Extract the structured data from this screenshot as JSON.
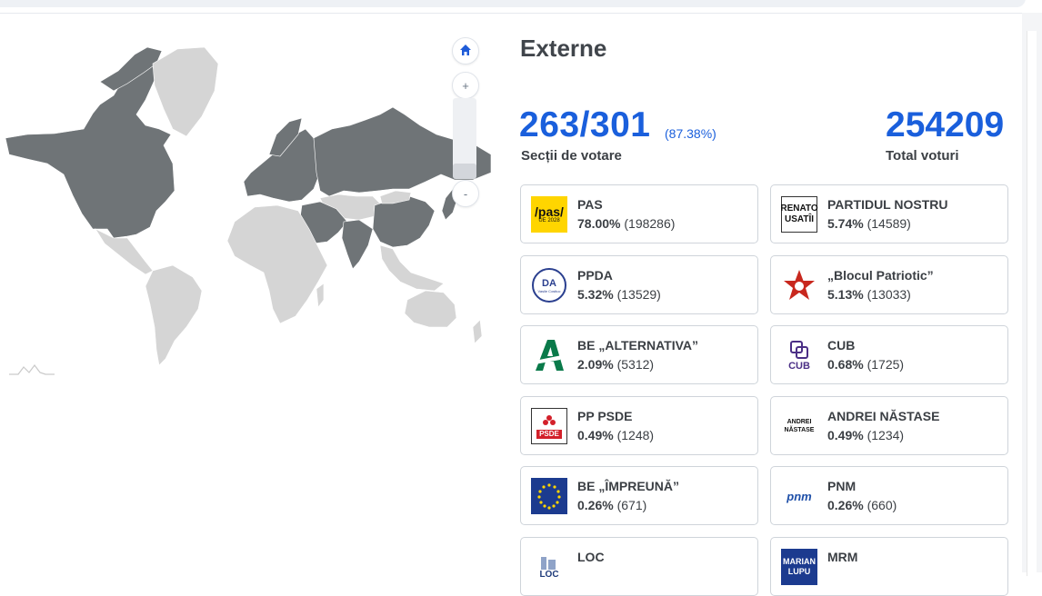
{
  "panel": {
    "title": "Externe",
    "sections_counted": "263/301",
    "sections_percent": "(87.38%)",
    "sections_label": "Secții de votare",
    "total_votes": "254209",
    "total_label": "Total voturi"
  },
  "map_controls": {
    "home_icon": "home-icon",
    "zoom_in": "+",
    "zoom_out": "-"
  },
  "colors": {
    "accent": "#1a5fdc",
    "map_active": "#6f7477",
    "map_inactive": "#d5d5d5"
  },
  "parties": [
    {
      "name": "PAS",
      "percent": "78.00%",
      "votes": "(198286)",
      "logo": "pas-logo",
      "logo_text": "/pas/",
      "logo_sub": "UE 2028"
    },
    {
      "name": "PARTIDUL NOSTRU",
      "percent": "5.74%",
      "votes": "(14589)",
      "logo": "renato-usatii-logo",
      "logo_text": "RENATO",
      "logo_sub": "USATÎI"
    },
    {
      "name": "PPDA",
      "percent": "5.32%",
      "votes": "(13529)",
      "logo": "ppda-logo",
      "logo_text": "DA",
      "logo_sub": "Vasile Costiuc"
    },
    {
      "name": "„Blocul Patriotic”",
      "percent": "5.13%",
      "votes": "(13033)",
      "logo": "red-star-logo"
    },
    {
      "name": "BE „ALTERNATIVA”",
      "percent": "2.09%",
      "votes": "(5312)",
      "logo": "alternativa-logo"
    },
    {
      "name": "CUB",
      "percent": "0.68%",
      "votes": "(1725)",
      "logo": "cub-logo",
      "logo_text": "CUB"
    },
    {
      "name": "PP PSDE",
      "percent": "0.49%",
      "votes": "(1248)",
      "logo": "psde-logo",
      "logo_text": "PSDE"
    },
    {
      "name": "ANDREI NĂSTASE",
      "percent": "0.49%",
      "votes": "(1234)",
      "logo": "andrei-nastase-logo",
      "logo_text": "ANDREI",
      "logo_sub": "NĂSTASE"
    },
    {
      "name": "BE „ÎMPREUNĂ”",
      "percent": "0.26%",
      "votes": "(671)",
      "logo": "impreuna-logo"
    },
    {
      "name": "PNM",
      "percent": "0.26%",
      "votes": "(660)",
      "logo": "pnm-logo",
      "logo_text": "pnm"
    },
    {
      "name": "LOC",
      "percent": "",
      "votes": "",
      "logo": "loc-logo",
      "logo_text": "LOC"
    },
    {
      "name": "MRM",
      "percent": "",
      "votes": "",
      "logo": "marian-lupu-logo",
      "logo_text": "MARIAN",
      "logo_sub": "LUPU"
    }
  ]
}
